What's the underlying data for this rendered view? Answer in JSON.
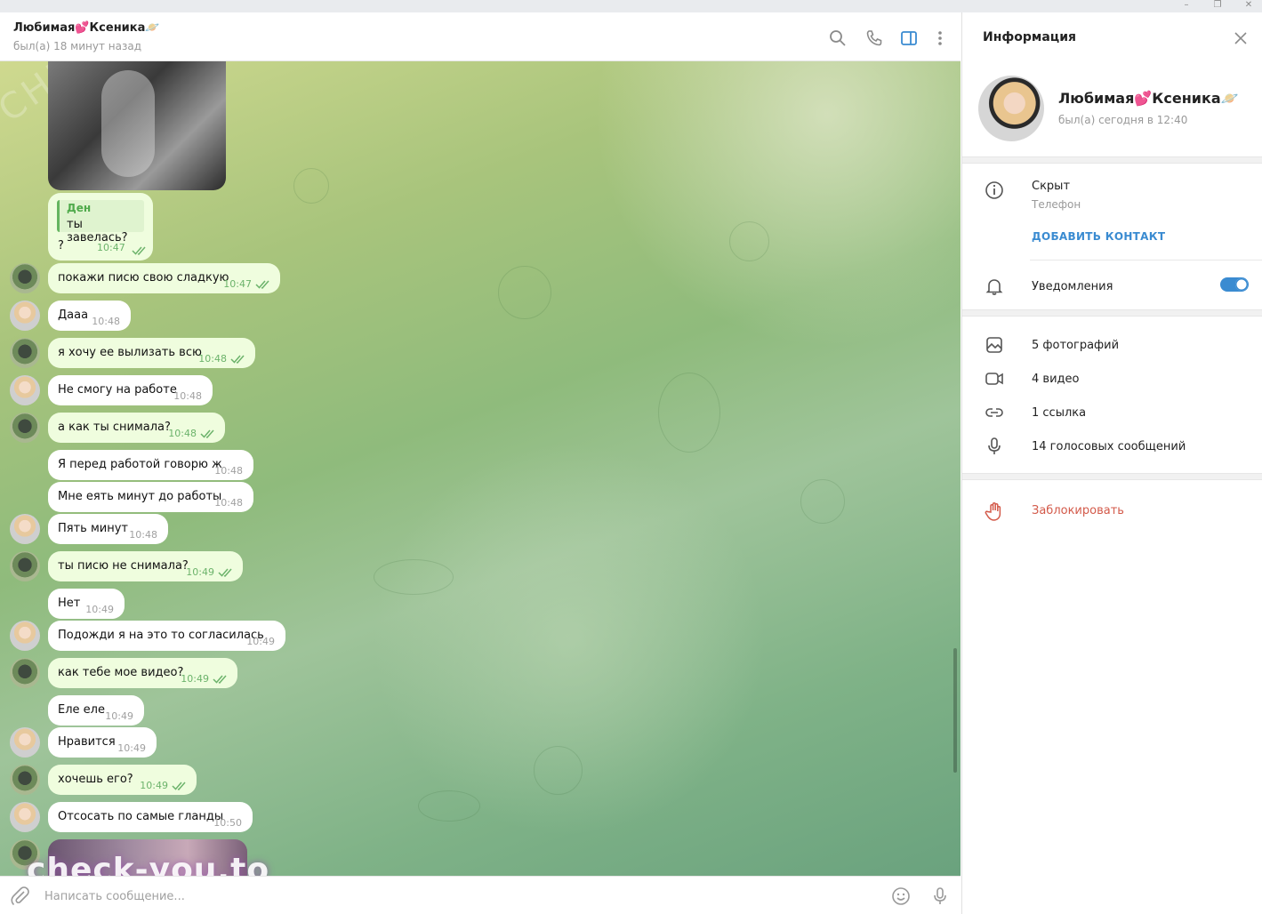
{
  "window": {
    "minimize": "–",
    "maximize": "❐",
    "close": "✕"
  },
  "header": {
    "name": "Любимая💕Ксеника🪐",
    "status": "был(а) 18 минут назад"
  },
  "messages": [
    {
      "dir": "in",
      "text": "Ден",
      "time": ""
    },
    {
      "dir": "out",
      "reply_author": "Ден",
      "reply_text": "ты завелась?",
      "text": "?",
      "time": "10:47"
    },
    {
      "dir": "out",
      "text": "покажи писю свою сладкую",
      "time": "10:47"
    },
    {
      "dir": "in",
      "text": "Дааа",
      "time": "10:48"
    },
    {
      "dir": "out",
      "text": "я хочу ее вылизать всю",
      "time": "10:48"
    },
    {
      "dir": "in",
      "text": "Не смогу на работе",
      "time": "10:48"
    },
    {
      "dir": "out",
      "text": "а как ты снимала?",
      "time": "10:48"
    },
    {
      "dir": "in",
      "text": "Я перед работой говорю ж",
      "time": "10:48"
    },
    {
      "dir": "in",
      "text": "Мне еять минут до работы",
      "time": "10:48"
    },
    {
      "dir": "in",
      "text": "Пять минут",
      "time": "10:48"
    },
    {
      "dir": "out",
      "text": "ты писю не снимала?",
      "time": "10:49"
    },
    {
      "dir": "in",
      "text": "Нет",
      "time": "10:49"
    },
    {
      "dir": "in",
      "text": "Подожди я на это то согласилась",
      "time": "10:49"
    },
    {
      "dir": "out",
      "text": "как тебе мое видео?",
      "time": "10:49"
    },
    {
      "dir": "in",
      "text": "Еле еле",
      "time": "10:49"
    },
    {
      "dir": "in",
      "text": "Нравится",
      "time": "10:49"
    },
    {
      "dir": "out",
      "text": "хочешь его?",
      "time": "10:49"
    },
    {
      "dir": "in",
      "text": "Отсосать по самые гланды",
      "time": "10:50"
    }
  ],
  "watermarks": {
    "bottom": "check-you.to",
    "diagonal": "CHECK YOU ME"
  },
  "composer": {
    "placeholder": "Написать сообщение..."
  },
  "panel": {
    "title": "Информация",
    "profile_name": "Любимая💕Ксеника🪐",
    "profile_status": "был(а) сегодня в 12:40",
    "phone_value": "Скрыт",
    "phone_label": "Телефон",
    "add_contact": "ДОБАВИТЬ КОНТАКТ",
    "notifications": "Уведомления",
    "notifications_on": true,
    "media": {
      "photos": "5 фотографий",
      "videos": "4 видео",
      "links": "1 ссылка",
      "voice": "14 голосовых сообщений"
    },
    "block": "Заблокировать"
  },
  "colors": {
    "accent": "#3a8bd1",
    "out_bubble": "#effdde",
    "tick": "#6cb36b",
    "danger": "#d35a4a"
  }
}
